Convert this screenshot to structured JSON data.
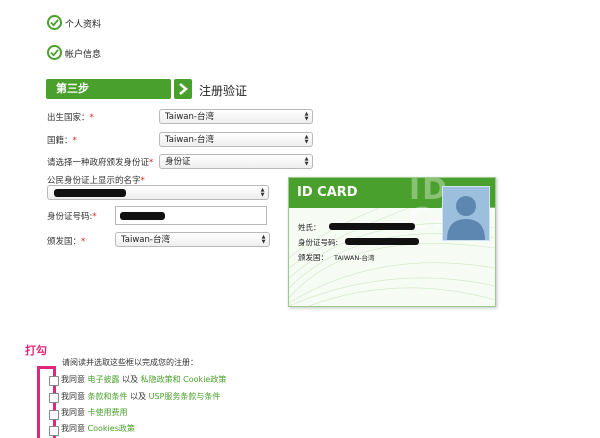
{
  "steps": {
    "completed": [
      {
        "label": "个人资料"
      },
      {
        "label": "帐户信息"
      }
    ],
    "current_badge": "第三步",
    "current_title": "注册验证"
  },
  "form": {
    "birth_country": {
      "label": "出生国家：",
      "value": "Taiwan-台湾"
    },
    "nationality": {
      "label": "国籍：",
      "value": "Taiwan-台湾"
    },
    "id_type": {
      "label": "请选择一种政府颁发身份证",
      "value": "身份证"
    },
    "name_on_id": {
      "label": "公民身份证上显示的名字"
    },
    "id_number": {
      "label": "身份证号码:"
    },
    "issuing_country": {
      "label": "颁发国：",
      "value": "Taiwan-台湾"
    }
  },
  "id_card": {
    "title": "ID CARD",
    "watermark": "ID CARD",
    "name_label": "姓氏：",
    "id_label": "身份证号码:",
    "issuer_label": "颁发国：",
    "issuer_value": "TAIWAN-台湾"
  },
  "annotation": {
    "text": "打勾",
    "color": "#e0287a"
  },
  "agreements": {
    "instruction": "请阅读并选取这些框以完成您的注册：",
    "items": [
      {
        "prefix": "我同意",
        "link1": "电子披露",
        "mid": "以及",
        "link2": "私隐政策和 Cookie政策"
      },
      {
        "prefix": "我同意",
        "link1": "条款和条件",
        "mid": "以及",
        "link2": "USP服务条款与条件"
      },
      {
        "prefix": "我同意",
        "link1": "卡使用费用",
        "mid": "",
        "link2": ""
      },
      {
        "prefix": "我同意",
        "link1": "Cookies政策",
        "mid": "",
        "link2": ""
      }
    ]
  },
  "colors": {
    "accent": "#4aa02c",
    "required": "#d9241c"
  }
}
